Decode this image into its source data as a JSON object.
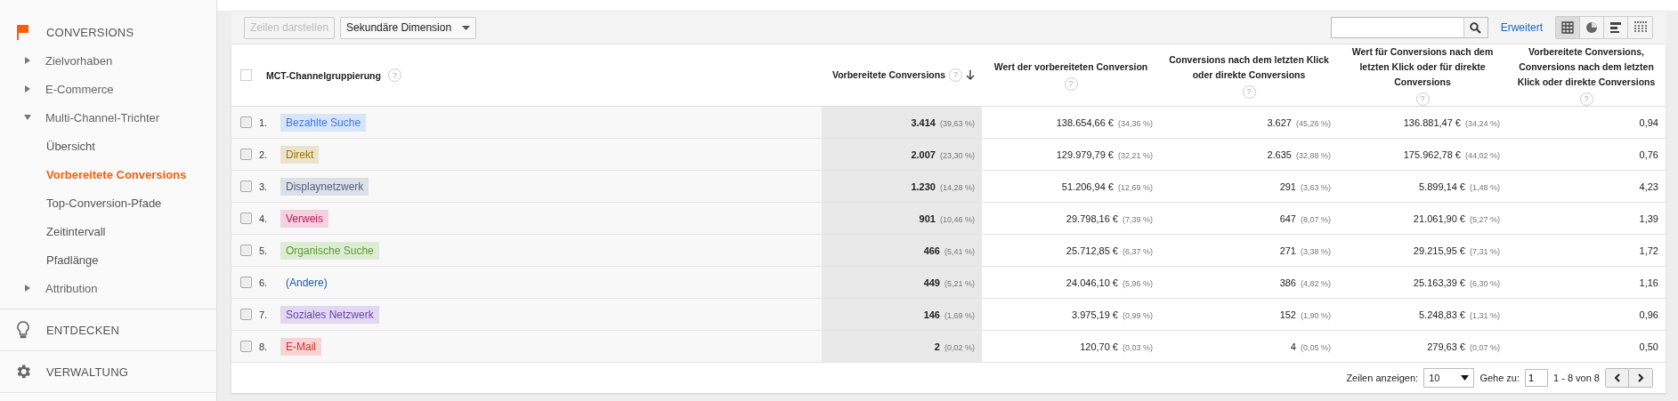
{
  "sidebar": {
    "sections": [
      {
        "kind": "flag",
        "label": "CONVERSIONS",
        "children": [
          {
            "label": "Zielvorhaben",
            "expanded": false
          },
          {
            "label": "E-Commerce",
            "expanded": false
          },
          {
            "label": "Multi-Channel-Trichter",
            "expanded": true,
            "children": [
              {
                "label": "Übersicht",
                "selected": false
              },
              {
                "label": "Vorbereitete Conversions",
                "selected": true
              },
              {
                "label": "Top-Conversion-Pfade",
                "selected": false
              },
              {
                "label": "Zeitintervall",
                "selected": false
              },
              {
                "label": "Pfadlänge",
                "selected": false
              }
            ]
          },
          {
            "label": "Attribution",
            "expanded": false
          }
        ]
      },
      {
        "kind": "bulb",
        "label": "ENTDECKEN"
      },
      {
        "kind": "gear",
        "label": "VERWALTUNG"
      }
    ]
  },
  "toolbar": {
    "plot_button": {
      "label": "Zeilen darstellen",
      "disabled": true
    },
    "secondary_dimension": "Sekundäre Dimension",
    "advanced_link": "Erweitert",
    "views": [
      {
        "kind": "table",
        "selected": true
      },
      {
        "kind": "pie",
        "selected": false
      },
      {
        "kind": "bars",
        "selected": false
      },
      {
        "kind": "pivot",
        "selected": false
      }
    ]
  },
  "table": {
    "select_all_checked": false,
    "columns": [
      {
        "label": "MCT-Channelgruppierung",
        "help": "?",
        "sorted": false
      },
      {
        "label": "Vorbereitete Conversions",
        "help": "?",
        "sorted": true
      },
      {
        "label": "Wert der vorbereiteten Conversion",
        "help": "?",
        "sorted": false
      },
      {
        "label": "Conversions nach dem letzten Klick oder direkte Conversions",
        "help": "?",
        "sorted": false
      },
      {
        "label": "Wert für Conversions nach dem letzten Klick oder für direkte Conversions",
        "help": "?",
        "sorted": false
      },
      {
        "label": "Vorbereitete Conversions, Conversions nach dem letzten Klick oder direkte Conversions",
        "help": "?",
        "sorted": false
      }
    ],
    "rows": [
      {
        "checked": false,
        "index": "1.",
        "channel": "Bezahlte Suche",
        "kind": "tag",
        "color": "#3b78e7",
        "assisted": "3.414",
        "assisted_share": "(39,63 %)",
        "assisted_value": "138.654,66 €",
        "assisted_value_share": "(34,36 %)",
        "last_click": "3.627",
        "last_click_share": "(45,26 %)",
        "last_click_value": "136.881,47 €",
        "last_click_value_share": "(34,24 %)",
        "ratio": "0,94"
      },
      {
        "checked": false,
        "index": "2.",
        "channel": "Direkt",
        "kind": "tag",
        "color": "#9a7400",
        "assisted": "2.007",
        "assisted_share": "(23,30 %)",
        "assisted_value": "129.979,79 €",
        "assisted_value_share": "(32,21 %)",
        "last_click": "2.635",
        "last_click_share": "(32,88 %)",
        "last_click_value": "175.962,78 €",
        "last_click_value_share": "(44,02 %)",
        "ratio": "0,76"
      },
      {
        "checked": false,
        "index": "3.",
        "channel": "Displaynetzwerk",
        "kind": "tag",
        "color": "#4f6286",
        "assisted": "1.230",
        "assisted_share": "(14,28 %)",
        "assisted_value": "51.206,94 €",
        "assisted_value_share": "(12,69 %)",
        "last_click": "291",
        "last_click_share": "(3,63 %)",
        "last_click_value": "5.899,14 €",
        "last_click_value_share": "(1,48 %)",
        "ratio": "4,23"
      },
      {
        "checked": false,
        "index": "4.",
        "channel": "Verweis",
        "kind": "tag",
        "color": "#c2185b",
        "assisted": "901",
        "assisted_share": "(10,46 %)",
        "assisted_value": "29.798,16 €",
        "assisted_value_share": "(7,39 %)",
        "last_click": "647",
        "last_click_share": "(8,07 %)",
        "last_click_value": "21.061,90 €",
        "last_click_value_share": "(5,27 %)",
        "ratio": "1,39"
      },
      {
        "checked": false,
        "index": "5.",
        "channel": "Organische Suche",
        "kind": "tag",
        "color": "#5a9e2f",
        "assisted": "466",
        "assisted_share": "(5,41 %)",
        "assisted_value": "25.712,85 €",
        "assisted_value_share": "(6,37 %)",
        "last_click": "271",
        "last_click_share": "(3,38 %)",
        "last_click_value": "29.215,95 €",
        "last_click_value_share": "(7,31 %)",
        "ratio": "1,72"
      },
      {
        "checked": false,
        "index": "6.",
        "channel": "(Andere)",
        "kind": "plain",
        "color": "#1a5bb5",
        "assisted": "449",
        "assisted_share": "(5,21 %)",
        "assisted_value": "24.046,10 €",
        "assisted_value_share": "(5,96 %)",
        "last_click": "386",
        "last_click_share": "(4,82 %)",
        "last_click_value": "25.163,39 €",
        "last_click_value_share": "(6,30 %)",
        "ratio": "1,16"
      },
      {
        "checked": false,
        "index": "7.",
        "channel": "Soziales Netzwerk",
        "kind": "tag",
        "color": "#6b3fb8",
        "assisted": "146",
        "assisted_share": "(1,69 %)",
        "assisted_value": "3.975,19 €",
        "assisted_value_share": "(0,99 %)",
        "last_click": "152",
        "last_click_share": "(1,90 %)",
        "last_click_value": "5.248,83 €",
        "last_click_value_share": "(1,31 %)",
        "ratio": "0,96"
      },
      {
        "checked": false,
        "index": "8.",
        "channel": "E-Mail",
        "kind": "tag",
        "color": "#d32f2f",
        "assisted": "2",
        "assisted_share": "(0,02 %)",
        "assisted_value": "120,70 €",
        "assisted_value_share": "(0,03 %)",
        "last_click": "4",
        "last_click_share": "(0,05 %)",
        "last_click_value": "279,63 €",
        "last_click_value_share": "(0,07 %)",
        "ratio": "0,50"
      }
    ]
  },
  "pagination": {
    "rows_label": "Zeilen anzeigen:",
    "rows_value": "10",
    "goto_label": "Gehe zu:",
    "goto_value": "1",
    "range": "1 - 8 von 8"
  }
}
